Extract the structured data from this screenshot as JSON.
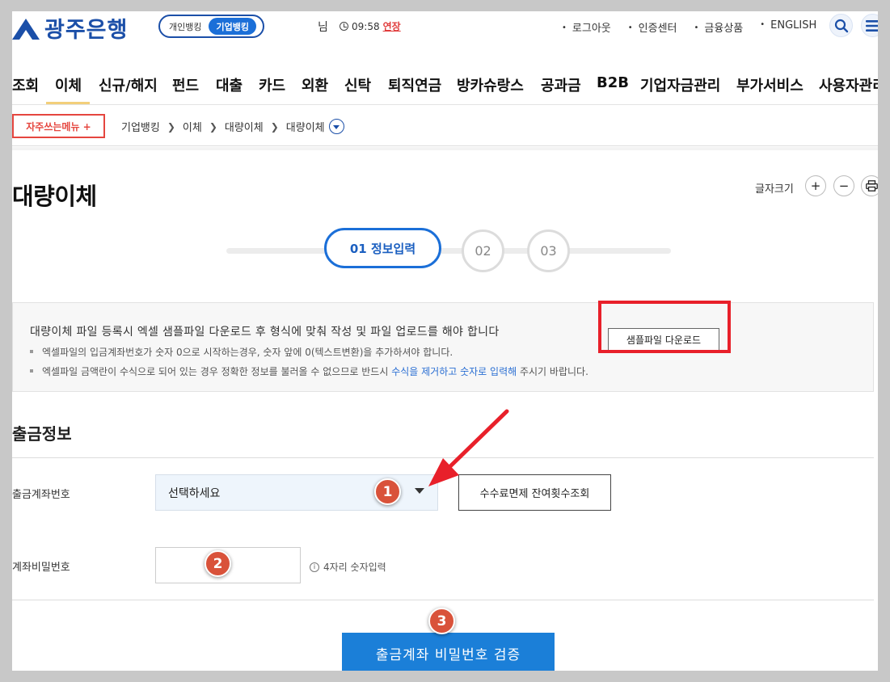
{
  "header": {
    "logo_text": "광주은행",
    "toggle": [
      {
        "label": "개인뱅킹"
      },
      {
        "label": "기업뱅킹"
      }
    ],
    "user_suffix": "님",
    "timer": "09:58",
    "extend_label": "연장",
    "util_links": [
      "로그아웃",
      "인증센터",
      "금융상품",
      "ENGLISH"
    ],
    "icons": [
      "search-icon",
      "hamburger-icon"
    ],
    "brand_color": "#1b4fa8"
  },
  "gnb": [
    "조회",
    "이체",
    "신규/해지",
    "펀드",
    "대출",
    "카드",
    "외환",
    "신탁",
    "퇴직연금",
    "방카슈랑스",
    "공과금",
    "B2B",
    "기업자금관리",
    "부가서비스",
    "사용자관리"
  ],
  "location": {
    "favorite_label": "자주쓰는메뉴 +",
    "crumbs": [
      "기업뱅킹",
      "이체",
      "대량이체",
      "대량이체"
    ]
  },
  "page": {
    "title": "대량이체",
    "fontsize_label": "글자크기",
    "plus": "+",
    "minus": "−"
  },
  "steps": [
    {
      "label": "01 정보입력",
      "active": true
    },
    {
      "label": "02",
      "active": false
    },
    {
      "label": "03",
      "active": false
    }
  ],
  "notice": {
    "main": "대량이체 파일 등록시 엑셀 샘플파일 다운로드 후 형식에 맞춰 작성 및 파일 업로드를 해야 합니다",
    "sample_button": "샘플파일 다운로드",
    "sub1": "엑셀파일의 입금계좌번호가 숫자 0으로 시작하는경우, 숫자 앞에 0(텍스트변환)을 추가하셔야 합니다.",
    "sub2_pre": "엑셀파일 금액란이 수식으로 되어 있는 경우 정확한 정보를 불러올 수 없으므로 반드시 ",
    "sub2_blue": "수식을 제거하고 숫자로 입력해",
    "sub2_post": " 주시기 바랍니다."
  },
  "form": {
    "section_title": "출금정보",
    "account_label": "출금계좌번호",
    "account_select": "선택하세요",
    "fee_button": "수수료면제 잔여횟수조회",
    "password_label": "계좌비밀번호",
    "password_hint": "4자리 숫자입력",
    "submit": "출금계좌 비밀번호 검증"
  },
  "annotations": {
    "badges": [
      "1",
      "2",
      "3"
    ],
    "highlight_color": "#e8202a"
  }
}
